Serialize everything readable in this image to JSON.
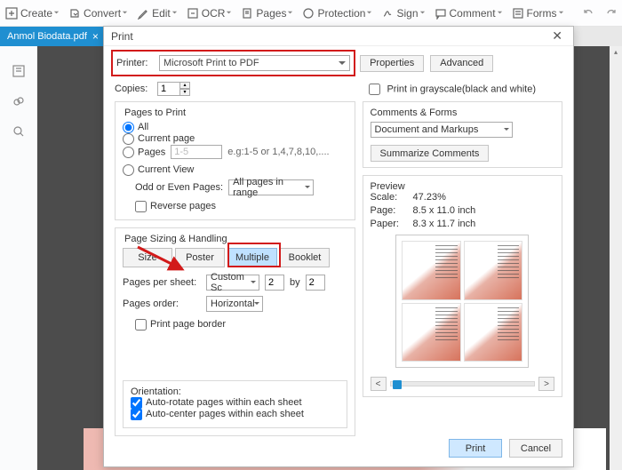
{
  "toolbar": {
    "create": "Create",
    "convert": "Convert",
    "edit": "Edit",
    "ocr": "OCR",
    "pages": "Pages",
    "protection": "Protection",
    "sign": "Sign",
    "comment": "Comment",
    "forms": "Forms"
  },
  "tab": {
    "filename": "Anmol Biodata.pdf"
  },
  "dialog": {
    "title": "Print",
    "printer_label": "Printer:",
    "printer_value": "Microsoft Print to PDF",
    "properties": "Properties",
    "advanced": "Advanced",
    "copies_label": "Copies:",
    "copies_value": "1",
    "grayscale": "Print in grayscale(black and white)",
    "pages_to_print": {
      "legend": "Pages to Print",
      "all": "All",
      "current_page": "Current page",
      "pages": "Pages",
      "pages_value": "1-5",
      "pages_hint": "e.g:1-5 or 1,4,7,8,10,....",
      "current_view": "Current View",
      "odd_even_label": "Odd or Even Pages:",
      "odd_even_value": "All pages in range",
      "reverse": "Reverse pages"
    },
    "sizing": {
      "legend": "Page Sizing & Handling",
      "size": "Size",
      "poster": "Poster",
      "multiple": "Multiple",
      "booklet": "Booklet",
      "pages_per_sheet": "Pages per sheet:",
      "pps_value": "Custom Sc",
      "pps_cols": "2",
      "by": "by",
      "pps_rows": "2",
      "pages_order_label": "Pages order:",
      "pages_order_value": "Horizontal",
      "print_border": "Print page border"
    },
    "comments": {
      "legend": "Comments & Forms",
      "value": "Document and Markups",
      "summarize": "Summarize Comments"
    },
    "preview": {
      "legend": "Preview",
      "scale_label": "Scale:",
      "scale_value": "47.23%",
      "page_label": "Page:",
      "page_value": "8.5 x 11.0 inch",
      "paper_label": "Paper:",
      "paper_value": "8.3 x 11.7 inch"
    },
    "orientation": {
      "legend": "Orientation:",
      "auto_rotate": "Auto-rotate pages within each sheet",
      "auto_center": "Auto-center pages within each sheet"
    },
    "footer": {
      "print": "Print",
      "cancel": "Cancel"
    }
  }
}
